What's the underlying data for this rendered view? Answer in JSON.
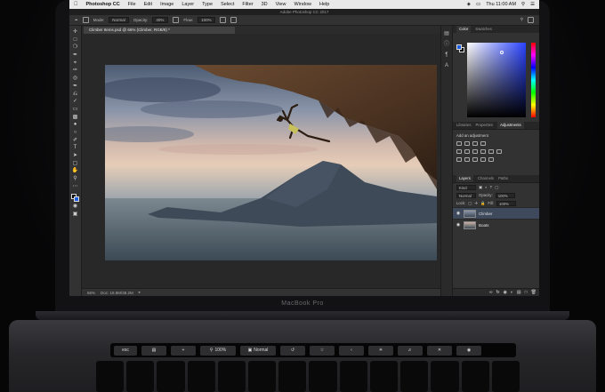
{
  "menubar": {
    "apple": "",
    "app_name": "Photoshop CC",
    "items": [
      "File",
      "Edit",
      "Image",
      "Layer",
      "Type",
      "Select",
      "Filter",
      "3D",
      "View",
      "Window",
      "Help"
    ],
    "clock": "Thu 11:00 AM"
  },
  "window_title": "Adobe Photoshop CC 2017",
  "options_bar": {
    "mode_label": "Mode:",
    "mode_value": "Normal",
    "opacity_label": "Opacity:",
    "opacity_value": "40%",
    "flow_label": "Flow:",
    "flow_value": "100%"
  },
  "document": {
    "tab_title": "Climber Items.psd @ 66% (Climber, RGB/8) *",
    "zoom": "66%",
    "doc_info": "Doc: 18.8M/38.2M"
  },
  "panels": {
    "color_tabs": [
      "Color",
      "Swatches"
    ],
    "adj_tabs": [
      "Libraries",
      "Properties",
      "Adjustments"
    ],
    "adj_title": "Add an adjustment",
    "layers_tabs": [
      "Layers",
      "Channels",
      "Paths"
    ],
    "kind_label": "Kind",
    "blend_mode": "Normal",
    "opacity_label": "Opacity:",
    "opacity_value": "100%",
    "lock_label": "Lock:",
    "fill_label": "Fill:",
    "fill_value": "100%",
    "layers": [
      {
        "name": "Climber",
        "selected": true
      },
      {
        "name": "Boats",
        "selected": false
      }
    ]
  },
  "laptop": {
    "brand": "MacBook Pro"
  },
  "touchbar": {
    "esc": "esc",
    "zoom": "100%",
    "blend": "Normal"
  },
  "colors": {
    "accent": "#1d5fe0",
    "panel_bg": "#323232",
    "canvas_bg": "#282828",
    "menubar_bg": "#e9e9e9"
  }
}
